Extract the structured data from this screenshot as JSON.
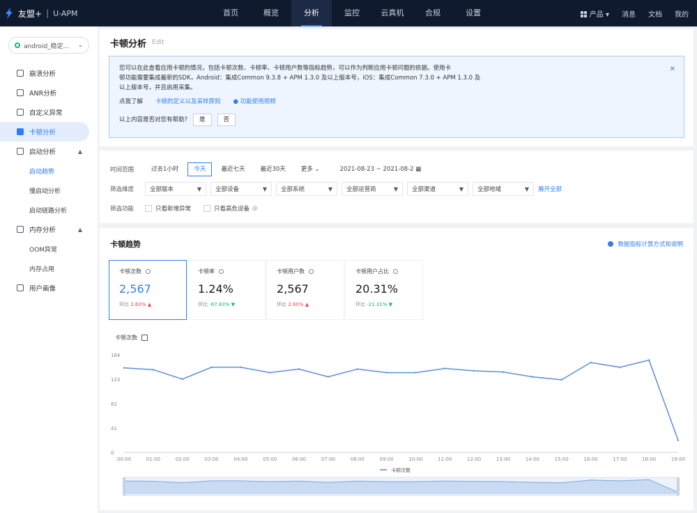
{
  "topbar": {
    "brand": "友盟+",
    "product": "U-APM",
    "nav": [
      "首页",
      "概览",
      "分析",
      "监控",
      "云真机",
      "合规",
      "设置"
    ],
    "active_nav": 2,
    "right": [
      "产品",
      "消息",
      "文档",
      "我的"
    ]
  },
  "sidebar": {
    "app": "android_稳定...",
    "items": [
      {
        "label": "崩溃分析",
        "type": "item"
      },
      {
        "label": "ANR分析",
        "type": "item"
      },
      {
        "label": "自定义异常",
        "type": "item"
      },
      {
        "label": "卡顿分析",
        "type": "item",
        "active": true
      },
      {
        "label": "启动分析",
        "type": "group"
      },
      {
        "label": "启动趋势",
        "type": "sub",
        "active": true
      },
      {
        "label": "慢启动分析",
        "type": "sub"
      },
      {
        "label": "启动链路分析",
        "type": "sub"
      },
      {
        "label": "内存分析",
        "type": "group"
      },
      {
        "label": "OOM异常",
        "type": "sub"
      },
      {
        "label": "内存占用",
        "type": "sub"
      },
      {
        "label": "用户画像",
        "type": "item"
      }
    ]
  },
  "page": {
    "title": "卡顿分析",
    "edit": "Edit"
  },
  "notice": {
    "line1": "您可以在此查看应用卡顿的情况，包括卡顿次数、卡顿率、卡顿用户数等指标趋势，可以作为判断应用卡顿问题的依据。使用卡",
    "line2": "顿功能需要集成最新的SDK，Android：集成Common 9.3.8 + APM 1.3.0 及以上版本号，iOS：集成Common 7.3.0 + APM 1.3.0 及",
    "line3": "以上版本号，并且启用采集。",
    "learn_more": "点我了解",
    "link1": "卡顿的定义以及采样原则",
    "link2": "功能使用视频",
    "feedback_q": "以上内容是否对您有帮助?",
    "yes": "是",
    "no": "否"
  },
  "filters": {
    "time_label": "时间范围",
    "time_options": [
      "过去1小时",
      "今天",
      "最近七天",
      "最近30天"
    ],
    "time_active": 1,
    "more": "更多",
    "date_range": "2021-08-23 ~ 2021-08-2",
    "filter_label": "筛选维度",
    "dropdowns": [
      "全部版本",
      "全部设备",
      "全部系统",
      "全部运营商",
      "全部渠道",
      "全部地域"
    ],
    "expand": "展开全部",
    "mode_label": "筛选功能",
    "check1": "只看新增异常",
    "check2": "只看高危设备"
  },
  "trend": {
    "title": "卡顿趋势",
    "help": "数据指标计算方式和说明",
    "cards": [
      {
        "name": "卡顿次数",
        "value": "2,567",
        "cmp_label": "环比",
        "cmp": "2.60%",
        "dir": "up"
      },
      {
        "name": "卡顿率",
        "value": "1.24%",
        "cmp_label": "环比",
        "cmp": "-67.83%",
        "dir": "down"
      },
      {
        "name": "卡顿用户数",
        "value": "2,567",
        "cmp_label": "环比",
        "cmp": "2.60%",
        "dir": "up"
      },
      {
        "name": "卡顿用户占比",
        "value": "20.31%",
        "cmp_label": "环比",
        "cmp": "-21.31%",
        "dir": "down"
      }
    ],
    "chart_tag": "卡顿次数"
  },
  "chart_data": {
    "type": "line",
    "x": [
      "00:00",
      "01:00",
      "02:00",
      "03:00",
      "04:00",
      "05:00",
      "06:00",
      "07:00",
      "08:00",
      "09:00",
      "10:00",
      "11:00",
      "12:00",
      "13:00",
      "14:00",
      "15:00",
      "16:00",
      "17:00",
      "18:00",
      "19:00"
    ],
    "y_ticks": [
      0,
      41,
      82,
      123,
      164
    ],
    "ylim": [
      0,
      164
    ],
    "series": [
      {
        "name": "卡顿次数",
        "values": [
          142,
          139,
          123,
          143,
          143,
          134,
          140,
          127,
          140,
          134,
          134,
          141,
          137,
          135,
          127,
          122,
          151,
          143,
          155,
          20
        ]
      }
    ],
    "color": "#5b8ed6",
    "legend_position": "bottom",
    "grid": false
  }
}
